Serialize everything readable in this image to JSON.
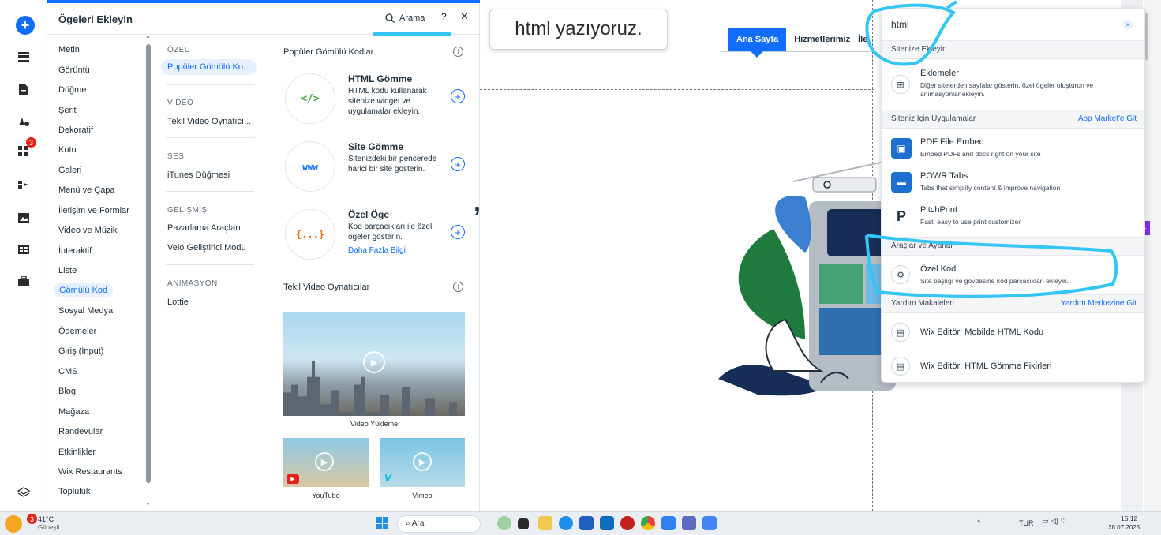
{
  "add_panel": {
    "title": "Ögeleri Ekleyin",
    "search_label": "Arama",
    "help": "?",
    "close": "✕",
    "categories": [
      "Metin",
      "Görüntü",
      "Düğme",
      "Şerit",
      "Dekoratif",
      "Kutu",
      "Galeri",
      "Menü ve Çapa",
      "İletişim ve Formlar",
      "Video ve Müzik",
      "İnteraktif",
      "Liste",
      "Gömülü Kod",
      "Sosyal Medya",
      "Ödemeler",
      "Giriş (Input)",
      "CMS",
      "Blog",
      "Mağaza",
      "Randevular",
      "Etkinlikler",
      "Wix Restaurants",
      "Topluluk"
    ],
    "selected_category": "Gömülü Kod",
    "sections": [
      {
        "title": "ÖZEL",
        "items": [
          "Popüler Gömülü Ko..."
        ]
      },
      {
        "title": "VİDEO",
        "items": [
          "Tekil Video Oynatıcı..."
        ]
      },
      {
        "title": "SES",
        "items": [
          "iTunes Düğmesi"
        ]
      },
      {
        "title": "GELİŞMİŞ",
        "items": [
          "Pazarlama Araçları",
          "Velo Geliştirici Modu"
        ]
      },
      {
        "title": "ANİMASYON",
        "items": [
          "Lottie"
        ]
      }
    ],
    "popular_heading": "Popüler Gömülü Kodlar",
    "embeds": [
      {
        "icon": "</>",
        "title": "HTML Gömme",
        "desc": "HTML kodu kullanarak sitenize widget ve uygulamalar ekleyin.",
        "link": ""
      },
      {
        "icon": "www",
        "title": "Site Gömme",
        "desc": "Sitenizdeki bir pencerede harici bir site gösterin.",
        "link": ""
      },
      {
        "icon": "{...}",
        "title": "Özel Öge",
        "desc": "Kod parçacıkları ile özel ögeler gösterin.",
        "link": "Daha Fazla Bilgi"
      }
    ],
    "video_heading": "Tekil Video Oynatıcılar",
    "videos": [
      {
        "caption": "Video Yükleme"
      },
      {
        "caption": "YouTube"
      },
      {
        "caption": "Vimeo"
      }
    ]
  },
  "canvas": {
    "tooltip": "html yazıyoruz.",
    "nav": {
      "home": "Ana Sayfa",
      "services": "Hizmetlerimiz",
      "more": "İle"
    },
    "hero_fragment": ","
  },
  "results": {
    "query": "html",
    "clear": "×",
    "bands": [
      {
        "title": "Sitenize Ekleyin",
        "link": ""
      },
      {
        "title": "Siteniz İçin Uygulamalar",
        "link": "App Market'e Git"
      },
      {
        "title": "Araçlar ve Ayarlar",
        "link": ""
      },
      {
        "title": "Yardım Makaleleri",
        "link": "Yardım Merkezine Git"
      }
    ],
    "items": [
      {
        "icon": "add-ons-icon",
        "glyph": "⊞",
        "title": "Eklemeler",
        "desc": "Diğer sitelerden sayfalar gösterin, özel ögeler oluşturun ve animasyonlar ekleyin."
      },
      {
        "icon": "pdf-icon",
        "glyph": "▣",
        "title": "PDF File Embed",
        "desc": "Embed PDFs and docs right on your site"
      },
      {
        "icon": "tabs-icon",
        "glyph": "▬",
        "title": "POWR Tabs",
        "desc": "Tabs that simplify content & improve navigation"
      },
      {
        "icon": "pitchprint-icon",
        "glyph": "P",
        "title": "PitchPrint",
        "desc": "Fast, easy to use print customizer"
      },
      {
        "icon": "settings-gear-icon",
        "glyph": "⚙",
        "title": "Özel Kod",
        "desc": "Site başlığı ve gövdesine kod parçacıkları ekleyin."
      },
      {
        "icon": "article-icon",
        "glyph": "▤",
        "title": "Wix Editör: Mobilde HTML Kodu",
        "desc": ""
      },
      {
        "icon": "article-icon",
        "glyph": "▤",
        "title": "Wix Editör: HTML Gömme Fikirleri",
        "desc": ""
      }
    ]
  },
  "iconbar": {
    "badge": "3"
  },
  "taskbar": {
    "weather_temp": "41°C",
    "weather_text": "Güneşli",
    "weather_badge": "3",
    "search": "Ara",
    "lang": "TUR",
    "time": "15:12",
    "date": "28.07.2025"
  },
  "colors": {
    "accent": "#116dff",
    "highlight": "#33c6f5",
    "pitch": "#8c26ff"
  }
}
